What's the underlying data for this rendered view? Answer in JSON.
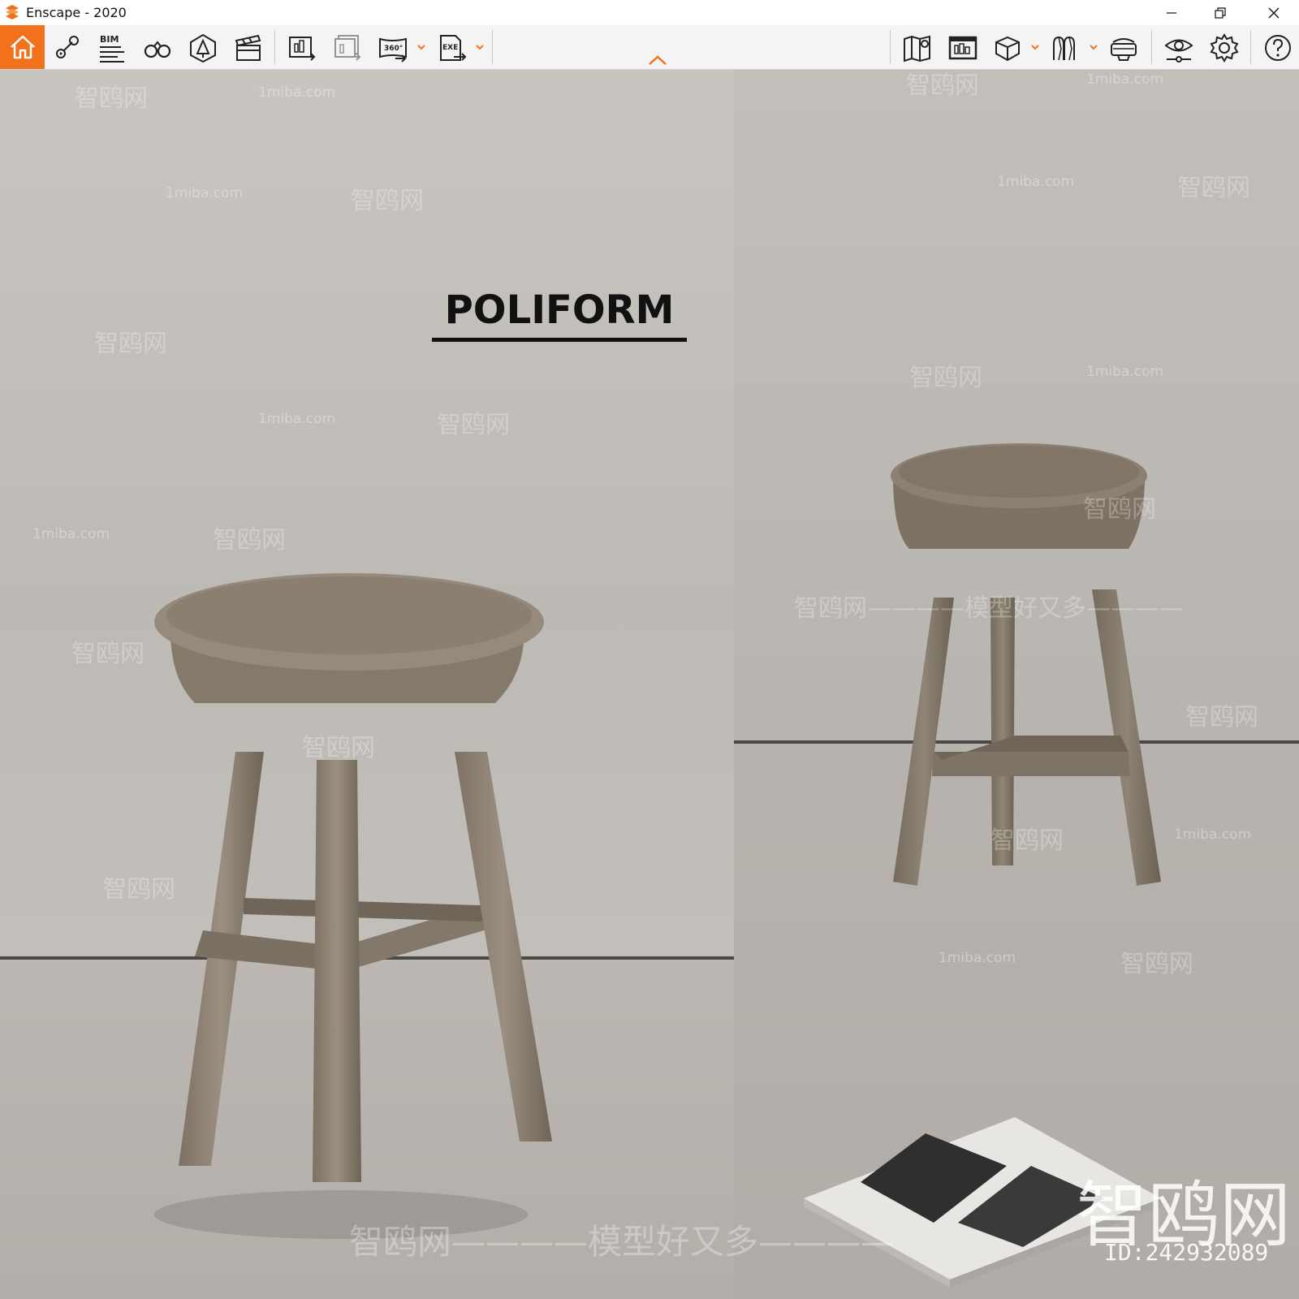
{
  "window": {
    "title": "Enscape - 2020",
    "accent": "#f2711c"
  },
  "toolbar": {
    "bim_label": "BIM",
    "panorama_label": "360°",
    "exe_label": "EXE",
    "items": [
      {
        "name": "home-icon"
      },
      {
        "name": "views-icon"
      },
      {
        "name": "bim-icon"
      },
      {
        "name": "binoculars-icon"
      },
      {
        "name": "asset-library-icon"
      },
      {
        "name": "video-editor-icon"
      },
      {
        "name": "render-image-icon"
      },
      {
        "name": "batch-render-icon"
      },
      {
        "name": "panorama-icon"
      },
      {
        "name": "export-exe-icon"
      },
      {
        "name": "map-icon"
      },
      {
        "name": "screenshot-icon"
      },
      {
        "name": "cube-icon"
      },
      {
        "name": "multiuser-icon"
      },
      {
        "name": "vr-headset-icon"
      },
      {
        "name": "visual-settings-icon"
      },
      {
        "name": "settings-gear-icon"
      },
      {
        "name": "help-icon"
      }
    ]
  },
  "scene": {
    "brand_text": "POLIFORM",
    "watermarks": {
      "site": "1miba.com",
      "cn": "智鸥网",
      "slogan": "智鸥网————模型好又多————",
      "slogan2": "智鸥网————模型好又多————",
      "big_logo": "智鸥网",
      "id": "ID:242932089"
    }
  }
}
